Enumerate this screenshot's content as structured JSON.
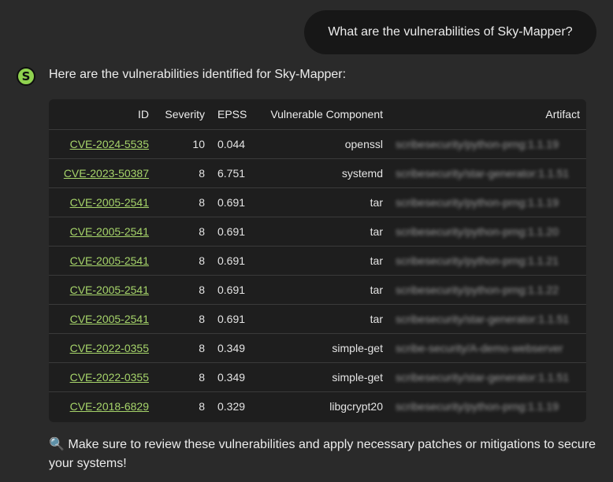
{
  "user_message": "What are the vulnerabilities of Sky-Mapper?",
  "assistant": {
    "avatar_letter": "S",
    "intro": "Here are the vulnerabilities identified for Sky-Mapper:",
    "table": {
      "headers": [
        "ID",
        "Severity",
        "EPSS",
        "Vulnerable Component",
        "Artifact"
      ],
      "rows": [
        {
          "id": "CVE-2024-5535",
          "severity": "10",
          "epss": "0.044",
          "component": "openssl",
          "artifact": "scribesecurity/python-prng:1.1.19"
        },
        {
          "id": "CVE-2023-50387",
          "severity": "8",
          "epss": "6.751",
          "component": "systemd",
          "artifact": "scribesecurity/star-generator:1.1.51"
        },
        {
          "id": "CVE-2005-2541",
          "severity": "8",
          "epss": "0.691",
          "component": "tar",
          "artifact": "scribesecurity/python-prng:1.1.19"
        },
        {
          "id": "CVE-2005-2541",
          "severity": "8",
          "epss": "0.691",
          "component": "tar",
          "artifact": "scribesecurity/python-prng:1.1.20"
        },
        {
          "id": "CVE-2005-2541",
          "severity": "8",
          "epss": "0.691",
          "component": "tar",
          "artifact": "scribesecurity/python-prng:1.1.21"
        },
        {
          "id": "CVE-2005-2541",
          "severity": "8",
          "epss": "0.691",
          "component": "tar",
          "artifact": "scribesecurity/python-prng:1.1.22"
        },
        {
          "id": "CVE-2005-2541",
          "severity": "8",
          "epss": "0.691",
          "component": "tar",
          "artifact": "scribesecurity/star-generator:1.1.51"
        },
        {
          "id": "CVE-2022-0355",
          "severity": "8",
          "epss": "0.349",
          "component": "simple-get",
          "artifact": "scribe-security/A-demo-webserver"
        },
        {
          "id": "CVE-2022-0355",
          "severity": "8",
          "epss": "0.349",
          "component": "simple-get",
          "artifact": "scribesecurity/star-generator:1.1.51"
        },
        {
          "id": "CVE-2018-6829",
          "severity": "8",
          "epss": "0.329",
          "component": "libgcrypt20",
          "artifact": "scribesecurity/python-prng:1.1.19"
        }
      ]
    },
    "footer_icon": "magnifying-glass-icon",
    "footer_text": "Make sure to review these vulnerabilities and apply necessary patches or mitigations to secure your systems!"
  },
  "colors": {
    "background": "#2a2a2a",
    "user_bubble": "#171717",
    "table_bg": "#1e1e1e",
    "link": "#a6d46a",
    "avatar": "#8fd14f"
  }
}
